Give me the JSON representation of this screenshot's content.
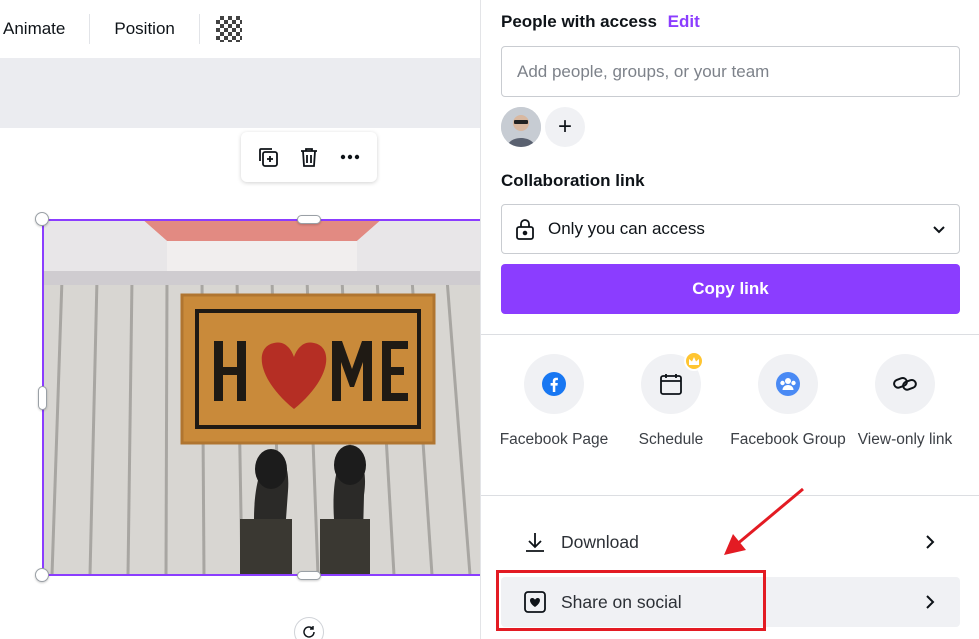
{
  "toolbar": {
    "animate_label": "Animate",
    "position_label": "Position",
    "transparency_icon": "transparency-checker-icon"
  },
  "context_menu": {
    "icons": [
      "duplicate-icon",
      "trash-icon",
      "more-icon"
    ]
  },
  "canvas": {
    "image_description_icon": "home-doormat-photo",
    "photo_text": "HOME"
  },
  "share_panel": {
    "people_with_access_label": "People with access",
    "edit_label": "Edit",
    "add_people_placeholder": "Add people, groups, or your team",
    "collaboration_link_label": "Collaboration link",
    "access_option": "Only you can access",
    "copy_link_label": "Copy link",
    "share_options": [
      {
        "label": "Facebook Page",
        "icon": "facebook-icon"
      },
      {
        "label": "Schedule",
        "icon": "calendar-icon",
        "premium": true
      },
      {
        "label": "Facebook Group",
        "icon": "facebook-group-icon"
      },
      {
        "label": "View-only link",
        "icon": "link-icon"
      }
    ],
    "download_label": "Download",
    "share_on_social_label": "Share on social"
  },
  "colors": {
    "accent": "#8b3dff",
    "highlight_annotation": "#e31b23",
    "premium_crown": "#ffc531"
  }
}
